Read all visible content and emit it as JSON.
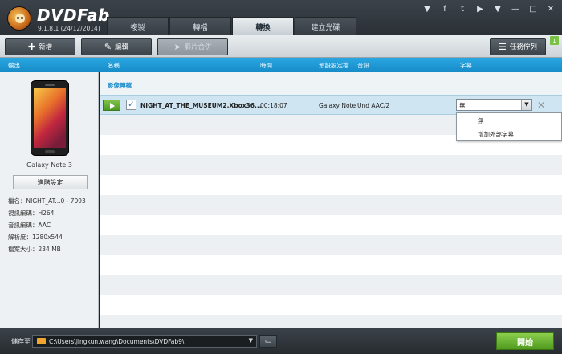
{
  "app": {
    "brand": "DVDFab",
    "version": "9.1.8.1 (24/12/2014)"
  },
  "tabs": [
    {
      "label": "複製"
    },
    {
      "label": "轉檔"
    },
    {
      "label": "轉換",
      "active": true
    },
    {
      "label": "建立光碟"
    }
  ],
  "window_controls": [
    "▼",
    "f",
    "t",
    "▶",
    "▼",
    "—",
    "□",
    "✕"
  ],
  "toolbar": {
    "add_label": "新增",
    "edit_label": "編輯",
    "merge_label": "影片合併",
    "queue_label": "任務佇列",
    "queue_count": "1"
  },
  "columns": {
    "output": "輸出",
    "name": "名稱",
    "time": "時間",
    "profile": "預設設定檔",
    "audio": "音訊",
    "subtitle": "字幕"
  },
  "device": {
    "name": "Galaxy Note 3",
    "advanced_label": "進階設定",
    "info": [
      "檔名：NIGHT_AT...0 - 7093",
      "視訊編碼：H264",
      "音訊編碼：AAC",
      "解析度：1280x544",
      "檔案大小：234 MB"
    ]
  },
  "group": {
    "label": "影像轉檔"
  },
  "file": {
    "name": "NIGHT_AT_THE_MUSEUM2.Xbox36...",
    "time": "00:18:07",
    "profile": "Galaxy Note",
    "audio": "Und AAC/2",
    "subtitle_value": "無"
  },
  "subtitle_options": [
    "無",
    "增加外部字幕"
  ],
  "bottom": {
    "save_label": "儲存至",
    "path": "C:\\Users\\jingkun.wang\\Documents\\DVDFab9\\",
    "start_label": "開始"
  },
  "colors": {
    "accent": "#168bc8",
    "start": "#5aa82a"
  }
}
